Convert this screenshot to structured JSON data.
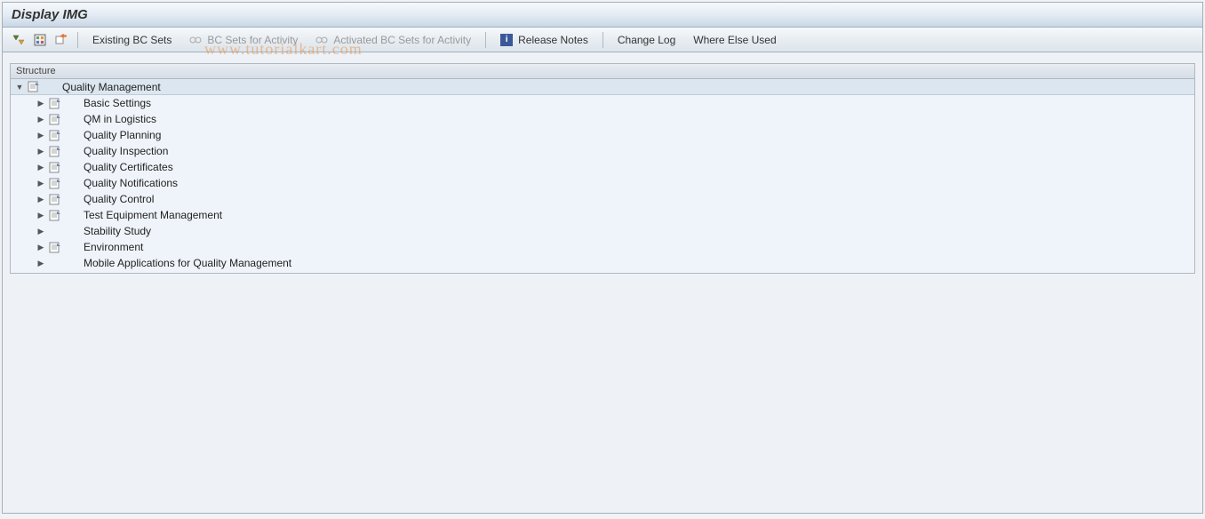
{
  "title": "Display IMG",
  "watermark": "www.tutorialkart.com",
  "toolbar": {
    "existing_bc_sets": "Existing BC Sets",
    "bc_sets_for_activity": "BC Sets for Activity",
    "activated_bc_sets": "Activated BC Sets for Activity",
    "release_notes": "Release Notes",
    "change_log": "Change Log",
    "where_else_used": "Where Else Used"
  },
  "tree": {
    "header": "Structure",
    "root": {
      "label": "Quality Management",
      "expanded": true,
      "has_doc": true
    },
    "children": [
      {
        "label": "Basic Settings",
        "has_doc": true
      },
      {
        "label": "QM in Logistics",
        "has_doc": true
      },
      {
        "label": "Quality Planning",
        "has_doc": true
      },
      {
        "label": "Quality Inspection",
        "has_doc": true
      },
      {
        "label": "Quality Certificates",
        "has_doc": true
      },
      {
        "label": "Quality Notifications",
        "has_doc": true
      },
      {
        "label": "Quality Control",
        "has_doc": true
      },
      {
        "label": "Test Equipment Management",
        "has_doc": true
      },
      {
        "label": "Stability Study",
        "has_doc": false
      },
      {
        "label": "Environment",
        "has_doc": true
      },
      {
        "label": "Mobile Applications for Quality Management",
        "has_doc": false
      }
    ]
  }
}
